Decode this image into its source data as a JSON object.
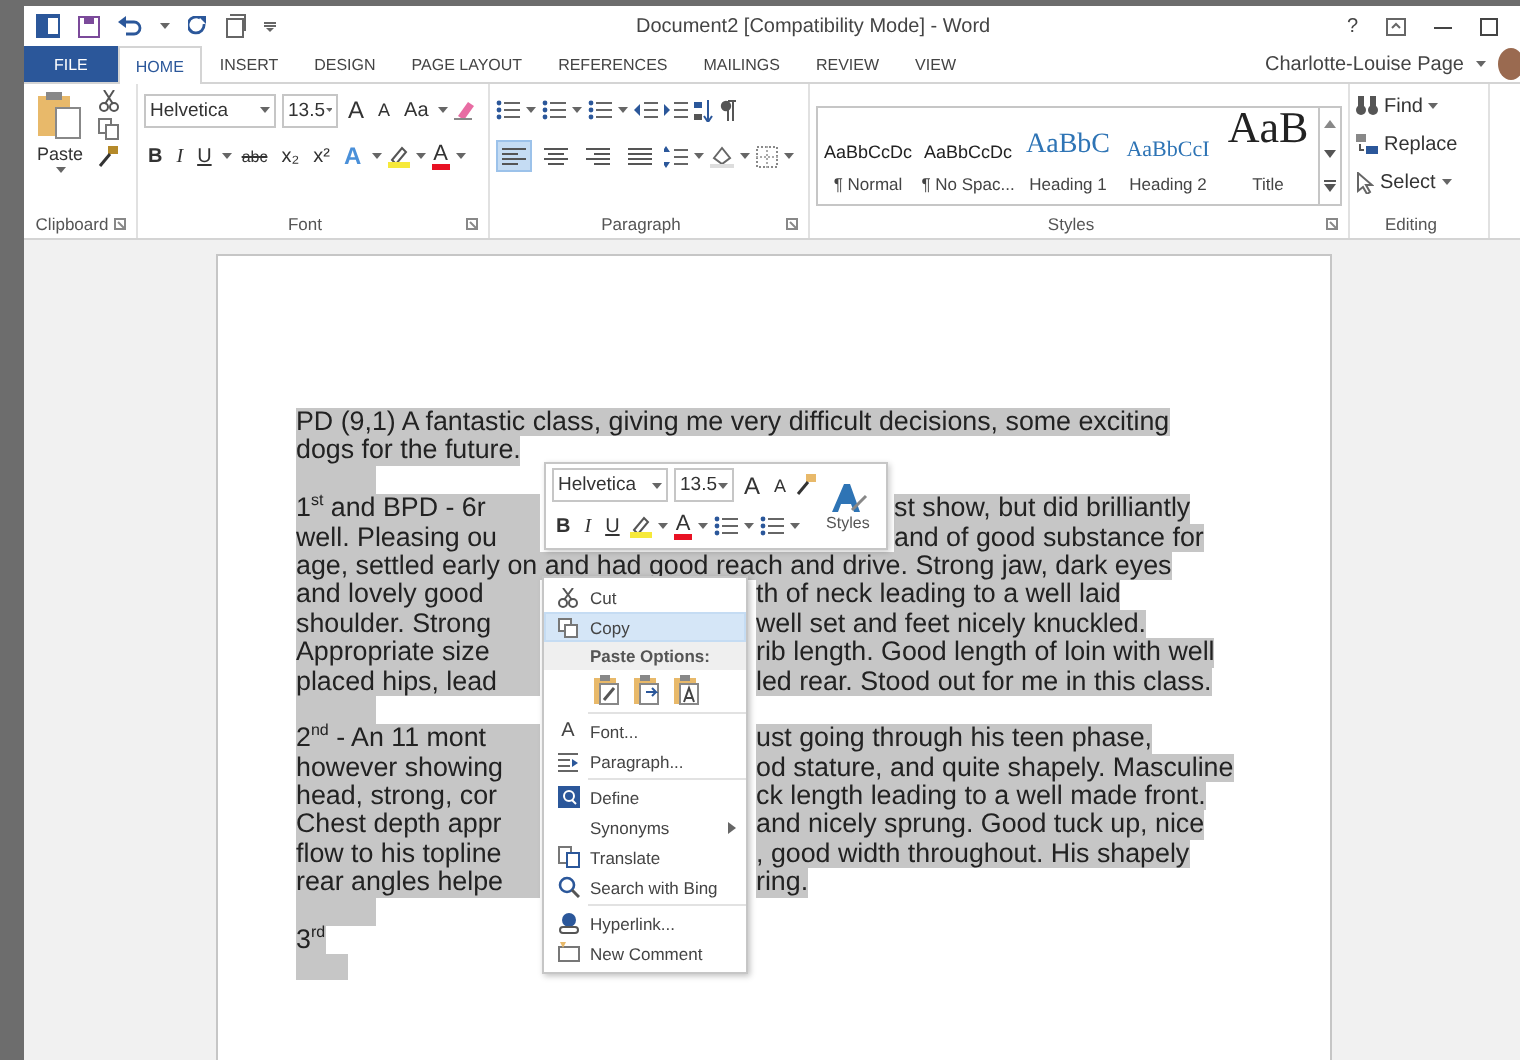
{
  "title_bar": {
    "title": "Document2 [Compatibility Mode] - Word",
    "help": "?"
  },
  "tabs": [
    {
      "label": "FILE",
      "kind": "file",
      "selected": false
    },
    {
      "label": "HOME",
      "kind": "tab",
      "selected": true
    },
    {
      "label": "INSERT",
      "kind": "tab",
      "selected": false
    },
    {
      "label": "DESIGN",
      "kind": "tab",
      "selected": false
    },
    {
      "label": "PAGE LAYOUT",
      "kind": "tab",
      "selected": false
    },
    {
      "label": "REFERENCES",
      "kind": "tab",
      "selected": false
    },
    {
      "label": "MAILINGS",
      "kind": "tab",
      "selected": false
    },
    {
      "label": "REVIEW",
      "kind": "tab",
      "selected": false
    },
    {
      "label": "VIEW",
      "kind": "tab",
      "selected": false
    }
  ],
  "account": {
    "name": "Charlotte-Louise Page"
  },
  "ribbon": {
    "clipboard": {
      "paste": "Paste",
      "label": "Clipboard"
    },
    "font": {
      "font_name": "Helvetica",
      "font_size": "13.5",
      "grow": "A",
      "shrink": "A",
      "case": "Aa",
      "label": "Font",
      "format_buttons": [
        {
          "label": "B",
          "kind": "bold"
        },
        {
          "label": "I",
          "kind": "italic"
        },
        {
          "label": "U",
          "kind": "underline"
        },
        {
          "label": "abc",
          "kind": "strike"
        },
        {
          "label": "x₂",
          "kind": "plain"
        },
        {
          "label": "x²",
          "kind": "plain"
        }
      ],
      "text_effects": "A",
      "font_color": "A"
    },
    "paragraph": {
      "label": "Paragraph",
      "alignments": [
        {
          "selected": true
        },
        {
          "selected": false
        },
        {
          "selected": false
        },
        {
          "selected": false
        }
      ]
    },
    "styles": {
      "label": "Styles",
      "items": [
        {
          "preview": "AaBbCcDc",
          "name": "¶ Normal",
          "kind": "normal"
        },
        {
          "preview": "AaBbCcDc",
          "name": "¶ No Spac...",
          "kind": "normal"
        },
        {
          "preview": "AaBbC",
          "name": "Heading 1",
          "kind": "heading1"
        },
        {
          "preview": "AaBbCcI",
          "name": "Heading 2",
          "kind": "heading2"
        },
        {
          "preview": "AaB",
          "name": "Title",
          "kind": "title"
        }
      ]
    },
    "editing": {
      "label": "Editing",
      "buttons": [
        {
          "label": "Find",
          "dropdown": true
        },
        {
          "label": "Replace",
          "dropdown": false
        },
        {
          "label": "Select",
          "dropdown": true
        }
      ]
    }
  },
  "document": {
    "paragraphs": [
      {
        "lines": [
          {
            "text": "PD (9,1) A fantastic class, giving me very difficult decisions, some exciting"
          },
          {
            "text": "dogs for the future."
          }
        ]
      },
      {
        "lines": [
          {
            "left": "1$^{st}$  and BPD - 6r",
            "right": "st show, but did brilliantly"
          },
          {
            "left": "well. Pleasing ou",
            "right": "and of good substance for"
          },
          {
            "text": "age, settled early on and had good reach and drive. Strong jaw, dark eyes"
          },
          {
            "left": "and lovely good",
            "right": "th of neck leading to a well laid"
          },
          {
            "left": "shoulder. Strong",
            "right": "well set and feet nicely knuckled."
          },
          {
            "left": "Appropriate size",
            "right": "rib length. Good length of loin with well"
          },
          {
            "left": "placed hips, lead",
            "right": "led rear. Stood out for me in this class."
          }
        ]
      },
      {
        "lines": [
          {
            "left": "2$^{nd}$ - An 11 mont",
            "right": "ust going through his teen phase,"
          },
          {
            "left": "however showing",
            "right": "od stature, and quite shapely. Masculine"
          },
          {
            "left": "head, strong, cor",
            "right": "ck length leading to a well made front."
          },
          {
            "left": "Chest depth appr",
            "right": "and nicely sprung. Good tuck up, nice"
          },
          {
            "left": "flow to his topline",
            "right": ", good width throughout. His shapely"
          },
          {
            "left": "rear angles helpe",
            "right": "ring."
          }
        ]
      },
      {
        "lines": [
          {
            "text": "3$^{rd}$"
          }
        ]
      }
    ]
  },
  "mini_toolbar": {
    "font_name": "Helvetica",
    "font_size": "13.5",
    "grow": "A",
    "shrink": "A",
    "styles": "Styles",
    "format_buttons": [
      {
        "label": "B",
        "kind": "bold"
      },
      {
        "label": "I",
        "kind": "italic"
      },
      {
        "label": "U",
        "kind": "underline"
      }
    ],
    "font_color": "A"
  },
  "context_menu": {
    "items": [
      {
        "kind": "command",
        "label": "Cut",
        "selected": false
      },
      {
        "kind": "command",
        "label": "Copy",
        "selected": true
      },
      {
        "kind": "header",
        "label": "Paste Options:"
      },
      {
        "kind": "paste-options"
      },
      {
        "kind": "separator"
      },
      {
        "kind": "command",
        "label": "Font...",
        "glyph": "A",
        "selected": false
      },
      {
        "kind": "command",
        "label": "Paragraph...",
        "selected": false
      },
      {
        "kind": "separator"
      },
      {
        "kind": "command",
        "label": "Define",
        "selected": false
      },
      {
        "kind": "submenu",
        "label": "Synonyms",
        "selected": false
      },
      {
        "kind": "command",
        "label": "Translate",
        "selected": false
      },
      {
        "kind": "command",
        "label": "Search with Bing",
        "selected": false
      },
      {
        "kind": "separator"
      },
      {
        "kind": "command",
        "label": "Hyperlink...",
        "selected": false
      },
      {
        "kind": "command",
        "label": "New Comment",
        "selected": false
      }
    ]
  }
}
